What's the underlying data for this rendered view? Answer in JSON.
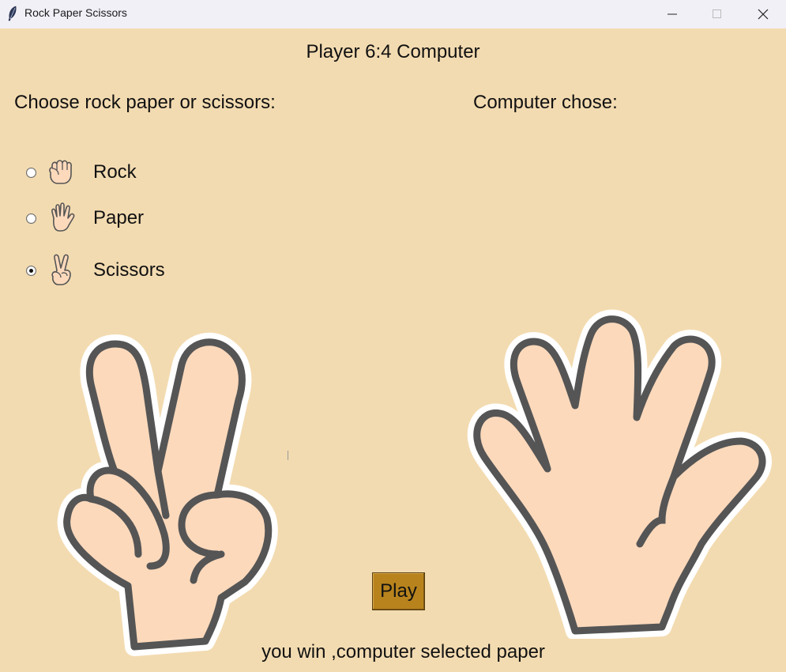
{
  "window": {
    "title": "Rock Paper Scissors",
    "icon": "feather-icon"
  },
  "score": "Player 6:4 Computer",
  "prompt": "Choose rock paper or scissors:",
  "computer_label": "Computer chose:",
  "options": [
    {
      "label": "Rock",
      "icon": "rock-hand-icon",
      "selected": false
    },
    {
      "label": "Paper",
      "icon": "paper-hand-icon",
      "selected": false
    },
    {
      "label": "Scissors",
      "icon": "scissors-hand-icon",
      "selected": true
    }
  ],
  "player_choice_image": "scissors-hand",
  "computer_choice_image": "paper-hand",
  "play_button": "Play",
  "result": "you win ,computer selected paper",
  "colors": {
    "background": "#f3dbb1",
    "button": "#b8831d",
    "skin": "#fcd9bb",
    "outline": "#555555"
  }
}
